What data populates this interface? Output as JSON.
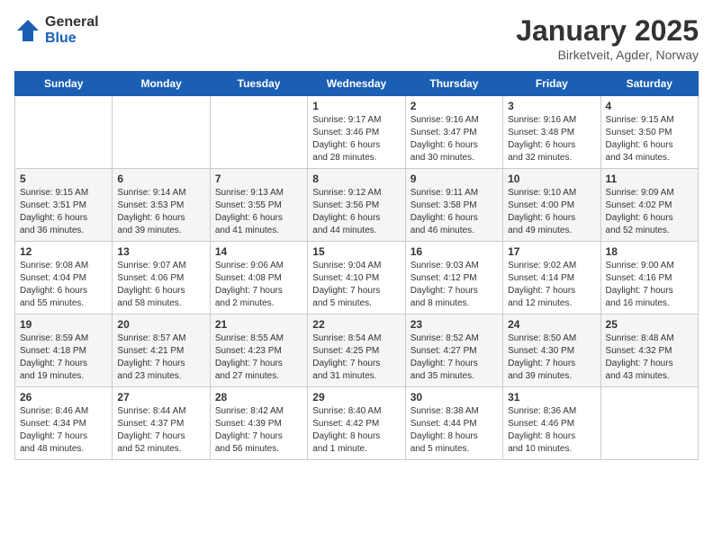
{
  "logo": {
    "general": "General",
    "blue": "Blue"
  },
  "title": "January 2025",
  "subtitle": "Birketveit, Agder, Norway",
  "days": [
    "Sunday",
    "Monday",
    "Tuesday",
    "Wednesday",
    "Thursday",
    "Friday",
    "Saturday"
  ],
  "weeks": [
    [
      {
        "num": "",
        "lines": []
      },
      {
        "num": "",
        "lines": []
      },
      {
        "num": "",
        "lines": []
      },
      {
        "num": "1",
        "lines": [
          "Sunrise: 9:17 AM",
          "Sunset: 3:46 PM",
          "Daylight: 6 hours",
          "and 28 minutes."
        ]
      },
      {
        "num": "2",
        "lines": [
          "Sunrise: 9:16 AM",
          "Sunset: 3:47 PM",
          "Daylight: 6 hours",
          "and 30 minutes."
        ]
      },
      {
        "num": "3",
        "lines": [
          "Sunrise: 9:16 AM",
          "Sunset: 3:48 PM",
          "Daylight: 6 hours",
          "and 32 minutes."
        ]
      },
      {
        "num": "4",
        "lines": [
          "Sunrise: 9:15 AM",
          "Sunset: 3:50 PM",
          "Daylight: 6 hours",
          "and 34 minutes."
        ]
      }
    ],
    [
      {
        "num": "5",
        "lines": [
          "Sunrise: 9:15 AM",
          "Sunset: 3:51 PM",
          "Daylight: 6 hours",
          "and 36 minutes."
        ]
      },
      {
        "num": "6",
        "lines": [
          "Sunrise: 9:14 AM",
          "Sunset: 3:53 PM",
          "Daylight: 6 hours",
          "and 39 minutes."
        ]
      },
      {
        "num": "7",
        "lines": [
          "Sunrise: 9:13 AM",
          "Sunset: 3:55 PM",
          "Daylight: 6 hours",
          "and 41 minutes."
        ]
      },
      {
        "num": "8",
        "lines": [
          "Sunrise: 9:12 AM",
          "Sunset: 3:56 PM",
          "Daylight: 6 hours",
          "and 44 minutes."
        ]
      },
      {
        "num": "9",
        "lines": [
          "Sunrise: 9:11 AM",
          "Sunset: 3:58 PM",
          "Daylight: 6 hours",
          "and 46 minutes."
        ]
      },
      {
        "num": "10",
        "lines": [
          "Sunrise: 9:10 AM",
          "Sunset: 4:00 PM",
          "Daylight: 6 hours",
          "and 49 minutes."
        ]
      },
      {
        "num": "11",
        "lines": [
          "Sunrise: 9:09 AM",
          "Sunset: 4:02 PM",
          "Daylight: 6 hours",
          "and 52 minutes."
        ]
      }
    ],
    [
      {
        "num": "12",
        "lines": [
          "Sunrise: 9:08 AM",
          "Sunset: 4:04 PM",
          "Daylight: 6 hours",
          "and 55 minutes."
        ]
      },
      {
        "num": "13",
        "lines": [
          "Sunrise: 9:07 AM",
          "Sunset: 4:06 PM",
          "Daylight: 6 hours",
          "and 58 minutes."
        ]
      },
      {
        "num": "14",
        "lines": [
          "Sunrise: 9:06 AM",
          "Sunset: 4:08 PM",
          "Daylight: 7 hours",
          "and 2 minutes."
        ]
      },
      {
        "num": "15",
        "lines": [
          "Sunrise: 9:04 AM",
          "Sunset: 4:10 PM",
          "Daylight: 7 hours",
          "and 5 minutes."
        ]
      },
      {
        "num": "16",
        "lines": [
          "Sunrise: 9:03 AM",
          "Sunset: 4:12 PM",
          "Daylight: 7 hours",
          "and 8 minutes."
        ]
      },
      {
        "num": "17",
        "lines": [
          "Sunrise: 9:02 AM",
          "Sunset: 4:14 PM",
          "Daylight: 7 hours",
          "and 12 minutes."
        ]
      },
      {
        "num": "18",
        "lines": [
          "Sunrise: 9:00 AM",
          "Sunset: 4:16 PM",
          "Daylight: 7 hours",
          "and 16 minutes."
        ]
      }
    ],
    [
      {
        "num": "19",
        "lines": [
          "Sunrise: 8:59 AM",
          "Sunset: 4:18 PM",
          "Daylight: 7 hours",
          "and 19 minutes."
        ]
      },
      {
        "num": "20",
        "lines": [
          "Sunrise: 8:57 AM",
          "Sunset: 4:21 PM",
          "Daylight: 7 hours",
          "and 23 minutes."
        ]
      },
      {
        "num": "21",
        "lines": [
          "Sunrise: 8:55 AM",
          "Sunset: 4:23 PM",
          "Daylight: 7 hours",
          "and 27 minutes."
        ]
      },
      {
        "num": "22",
        "lines": [
          "Sunrise: 8:54 AM",
          "Sunset: 4:25 PM",
          "Daylight: 7 hours",
          "and 31 minutes."
        ]
      },
      {
        "num": "23",
        "lines": [
          "Sunrise: 8:52 AM",
          "Sunset: 4:27 PM",
          "Daylight: 7 hours",
          "and 35 minutes."
        ]
      },
      {
        "num": "24",
        "lines": [
          "Sunrise: 8:50 AM",
          "Sunset: 4:30 PM",
          "Daylight: 7 hours",
          "and 39 minutes."
        ]
      },
      {
        "num": "25",
        "lines": [
          "Sunrise: 8:48 AM",
          "Sunset: 4:32 PM",
          "Daylight: 7 hours",
          "and 43 minutes."
        ]
      }
    ],
    [
      {
        "num": "26",
        "lines": [
          "Sunrise: 8:46 AM",
          "Sunset: 4:34 PM",
          "Daylight: 7 hours",
          "and 48 minutes."
        ]
      },
      {
        "num": "27",
        "lines": [
          "Sunrise: 8:44 AM",
          "Sunset: 4:37 PM",
          "Daylight: 7 hours",
          "and 52 minutes."
        ]
      },
      {
        "num": "28",
        "lines": [
          "Sunrise: 8:42 AM",
          "Sunset: 4:39 PM",
          "Daylight: 7 hours",
          "and 56 minutes."
        ]
      },
      {
        "num": "29",
        "lines": [
          "Sunrise: 8:40 AM",
          "Sunset: 4:42 PM",
          "Daylight: 8 hours",
          "and 1 minute."
        ]
      },
      {
        "num": "30",
        "lines": [
          "Sunrise: 8:38 AM",
          "Sunset: 4:44 PM",
          "Daylight: 8 hours",
          "and 5 minutes."
        ]
      },
      {
        "num": "31",
        "lines": [
          "Sunrise: 8:36 AM",
          "Sunset: 4:46 PM",
          "Daylight: 8 hours",
          "and 10 minutes."
        ]
      },
      {
        "num": "",
        "lines": []
      }
    ]
  ]
}
